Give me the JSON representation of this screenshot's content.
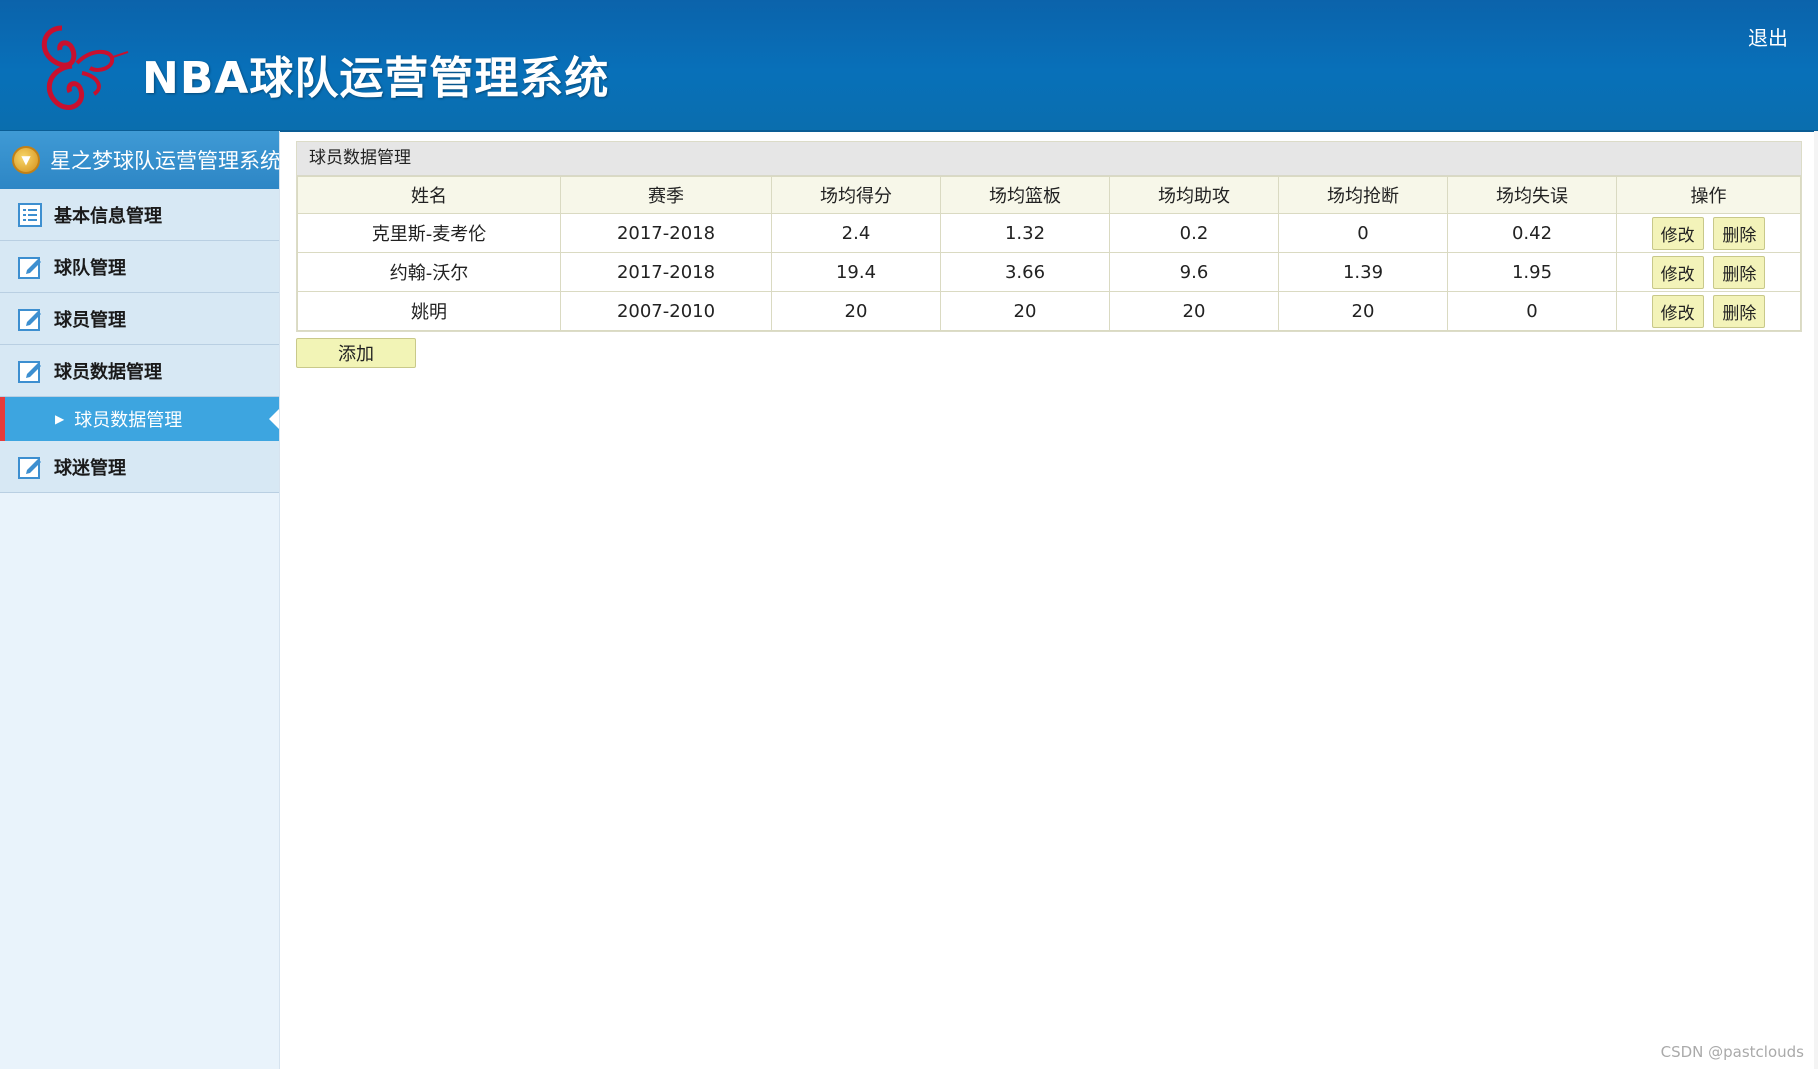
{
  "header": {
    "title": "NBA球队运营管理系统",
    "logout": "退出",
    "logo_icon": "butterfly-logo-icon"
  },
  "sidebar": {
    "head": "星之梦球队运营管理系统",
    "items": [
      {
        "label": "基本信息管理",
        "icon": "list-icon"
      },
      {
        "label": "球队管理",
        "icon": "edit-icon"
      },
      {
        "label": "球员管理",
        "icon": "edit-icon"
      },
      {
        "label": "球员数据管理",
        "icon": "edit-icon"
      },
      {
        "label": "球迷管理",
        "icon": "edit-icon"
      }
    ],
    "active_sub": "球员数据管理"
  },
  "main": {
    "panel_title": "球员数据管理",
    "columns": [
      "姓名",
      "赛季",
      "场均得分",
      "场均篮板",
      "场均助攻",
      "场均抢断",
      "场均失误",
      "操作"
    ],
    "rows": [
      {
        "name": "克里斯-麦考伦",
        "season": "2017-2018",
        "points": "2.4",
        "rebounds": "1.32",
        "assists": "0.2",
        "steals": "0",
        "turnovers": "0.42"
      },
      {
        "name": "约翰-沃尔",
        "season": "2017-2018",
        "points": "19.4",
        "rebounds": "3.66",
        "assists": "9.6",
        "steals": "1.39",
        "turnovers": "1.95"
      },
      {
        "name": "姚明",
        "season": "2007-2010",
        "points": "20",
        "rebounds": "20",
        "assists": "20",
        "steals": "20",
        "turnovers": "0"
      }
    ],
    "edit_label": "修改",
    "delete_label": "删除",
    "add_label": "添加"
  },
  "watermark": "CSDN @pastclouds",
  "colors": {
    "header": "#0870b9",
    "sidebar_bg": "#e9f3fb",
    "active_sub": "#3da5e0",
    "active_marker": "#e83b3b",
    "button": "#f3f3b9"
  }
}
